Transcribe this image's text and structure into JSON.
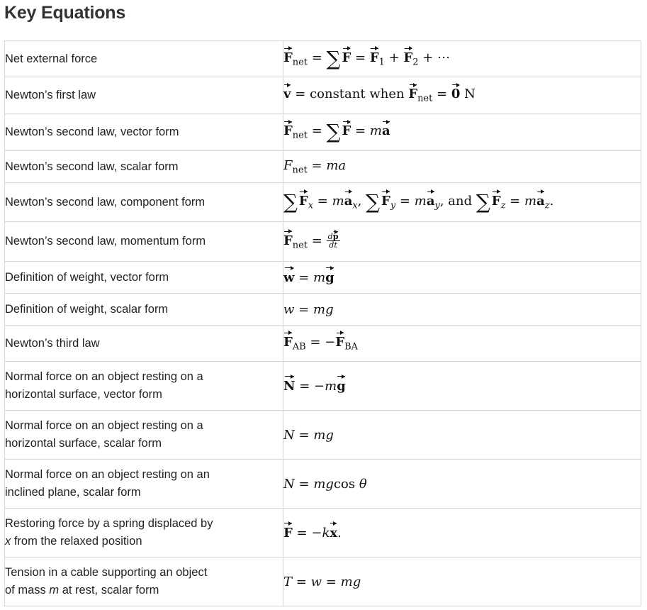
{
  "page": {
    "title": "Key Equations"
  },
  "rows": [
    {
      "description": "Net external force"
    },
    {
      "description": "Newton’s first law",
      "eq": {
        "constant": "constant when",
        "unit": "N"
      }
    },
    {
      "description": "Newton’s second law, vector form"
    },
    {
      "description": "Newton’s second law, scalar form"
    },
    {
      "description": "Newton’s second law, component form",
      "eq": {
        "and": "and"
      }
    },
    {
      "description": "Newton’s second law, momentum form"
    },
    {
      "description": "Definition of weight, vector form"
    },
    {
      "description": "Definition of weight, scalar form"
    },
    {
      "description": "Newton’s third law"
    },
    {
      "description_line1": "Normal force on an object resting on a",
      "description_line2": "horizontal surface, vector form"
    },
    {
      "description_line1": "Normal force on an object resting on a",
      "description_line2": "horizontal surface, scalar form"
    },
    {
      "description_line1": "Normal force on an object resting on an",
      "description_line2": "inclined plane, scalar form",
      "eq": {
        "cos": "cos"
      }
    },
    {
      "description_line1": "Restoring force by a spring displaced by",
      "description_line2_var": "x",
      "description_line2_rest": " from the relaxed position"
    },
    {
      "description_line1": "Tension in a cable supporting an object",
      "description_line2_pre": "of mass ",
      "description_line2_var": "m",
      "description_line2_rest": " at rest, scalar form"
    }
  ],
  "symbols": {
    "net": "net",
    "AB": "AB",
    "BA": "BA"
  }
}
